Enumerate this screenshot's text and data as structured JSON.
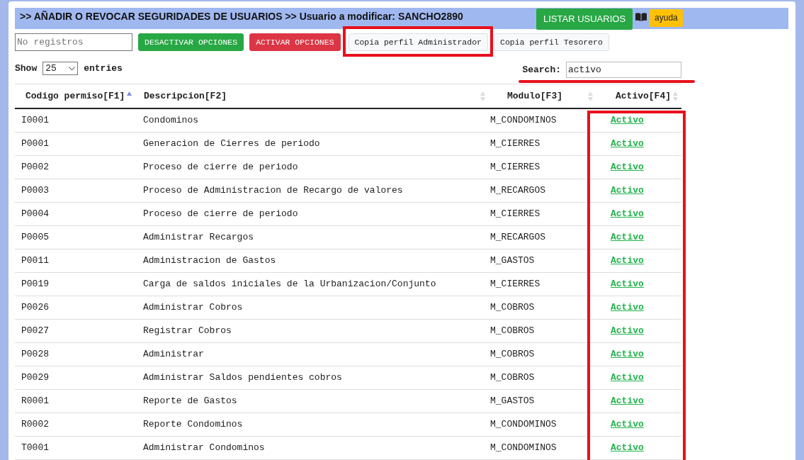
{
  "header": {
    "title": ">> AÑADIR O REVOCAR SEGURIDADES DE USUARIOS >> Usuario a modificar: SANCHO2890",
    "list_button": "LISTAR USUARIOS",
    "help_button": "ayuda"
  },
  "toolbar": {
    "records_field": {
      "placeholder": "No registros"
    },
    "buttons": [
      {
        "label": "DESACTIVAR OPCIONES",
        "kind": "success",
        "highlighted": false
      },
      {
        "label": "ACTIVAR OPCIONES",
        "kind": "danger",
        "highlighted": false
      },
      {
        "label": "Copia perfil Administrador",
        "kind": "light",
        "highlighted": true
      },
      {
        "label": "Copia perfil Tesorero",
        "kind": "light",
        "highlighted": false
      }
    ]
  },
  "length_control": {
    "prefix": "Show",
    "value": "25",
    "suffix": "entries"
  },
  "search": {
    "label": "Search:",
    "value": "activo"
  },
  "table": {
    "columns": [
      {
        "label": "Codigo permiso[F1]",
        "sorted": true
      },
      {
        "label": "Descripcion[F2]",
        "sorted": false
      },
      {
        "label": "Modulo[F3]",
        "sorted": false
      },
      {
        "label": "Activo[F4]",
        "sorted": false
      }
    ],
    "rows": [
      [
        "I0001",
        "Condominos",
        "M_CONDOMINOS",
        "Activo"
      ],
      [
        "P0001",
        "Generacion de Cierres de periodo",
        "M_CIERRES",
        "Activo"
      ],
      [
        "P0002",
        "Proceso de cierre de periodo",
        "M_CIERRES",
        "Activo"
      ],
      [
        "P0003",
        "Proceso de Administracion de Recargo de valores",
        "M_RECARGOS",
        "Activo"
      ],
      [
        "P0004",
        "Proceso de cierre de periodo",
        "M_CIERRES",
        "Activo"
      ],
      [
        "P0005",
        "Administrar Recargos",
        "M_RECARGOS",
        "Activo"
      ],
      [
        "P0011",
        "Administracion de Gastos",
        "M_GASTOS",
        "Activo"
      ],
      [
        "P0019",
        "Carga de saldos iniciales de la Urbanizacion/Conjunto",
        "M_CIERRES",
        "Activo"
      ],
      [
        "P0026",
        "Administrar Cobros",
        "M_COBROS",
        "Activo"
      ],
      [
        "P0027",
        "Registrar Cobros",
        "M_COBROS",
        "Activo"
      ],
      [
        "P0028",
        "Administrar",
        "M_COBROS",
        "Activo"
      ],
      [
        "P0029",
        "Administrar Saldos pendientes cobros",
        "M_COBROS",
        "Activo"
      ],
      [
        "R0001",
        "Reporte de Gastos",
        "M_GASTOS",
        "Activo"
      ],
      [
        "R0002",
        "Reporte Condominos",
        "M_CONDOMINOS",
        "Activo"
      ],
      [
        "T0001",
        "Administrar Condominos",
        "M_CONDOMINOS",
        "Activo"
      ]
    ]
  }
}
